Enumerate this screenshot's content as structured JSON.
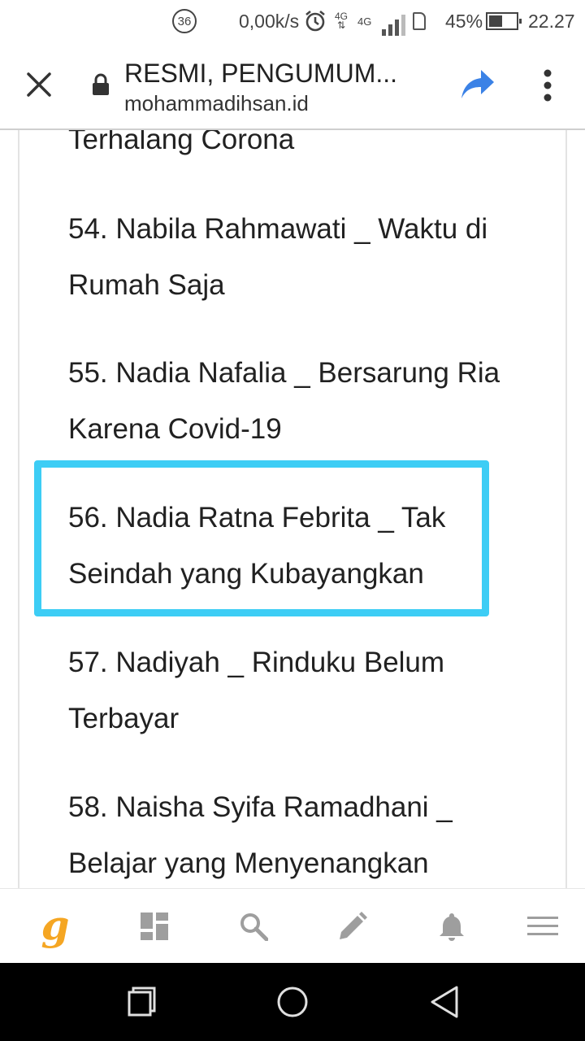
{
  "status_bar": {
    "notification_count": "36",
    "net_speed": "0,00k/s",
    "network_type_1": "4G",
    "network_type_2": "4G",
    "battery_percent": "45%",
    "time": "22.27"
  },
  "url_bar": {
    "title": "RESMI, PENGUMUM...",
    "domain": "mohammadihsan.id"
  },
  "content": {
    "partial_top": "Terhalang Corona",
    "entries": [
      {
        "text": "54. Nabila Rahmawati _ Waktu di Rumah Saja"
      },
      {
        "text": "55. Nadia Nafalia _ Bersarung Ria Karena Covid-19"
      },
      {
        "text": "56. Nadia Ratna Febrita _ Tak Seindah yang Kubayangkan"
      },
      {
        "text": "57. Nadiyah _ Rinduku Belum Terbayar"
      },
      {
        "text": "58. Naisha Syifa Ramadhani _ Belajar yang Menyenangkan"
      }
    ],
    "highlight_color": "#3dcdf5"
  },
  "toolbar": {
    "logo": "g",
    "logo_color": "#f5a623",
    "icons": [
      "dashboard-icon",
      "search-icon",
      "pencil-icon",
      "bell-icon",
      "menu-icon"
    ]
  },
  "nav_bar": {
    "icons": [
      "recents-icon",
      "home-icon",
      "back-icon"
    ]
  }
}
